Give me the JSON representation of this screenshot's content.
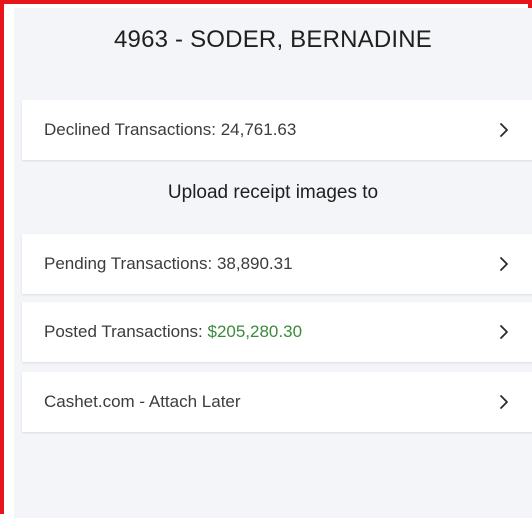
{
  "header": {
    "title": "4963 - SODER, BERNADINE"
  },
  "rows": {
    "declined": {
      "label": "Declined Transactions: 24,761.63",
      "icon": "chevron-right-icon"
    },
    "pending": {
      "label": "Pending Transactions: 38,890.31",
      "icon": "chevron-right-icon"
    },
    "posted": {
      "label": "Posted Transactions: ",
      "amount": "$205,280.30",
      "amount_color": "#3d8a3d",
      "icon": "chevron-right-icon"
    },
    "cashet": {
      "label": "Cashet.com - Attach Later",
      "icon": "chevron-right-icon"
    }
  },
  "upload": {
    "heading": "Upload receipt images to"
  },
  "colors": {
    "frame_border": "#e8141b",
    "panel_bg": "#f4f5f8",
    "row_bg": "#ffffff",
    "text": "#3c3c3c"
  }
}
